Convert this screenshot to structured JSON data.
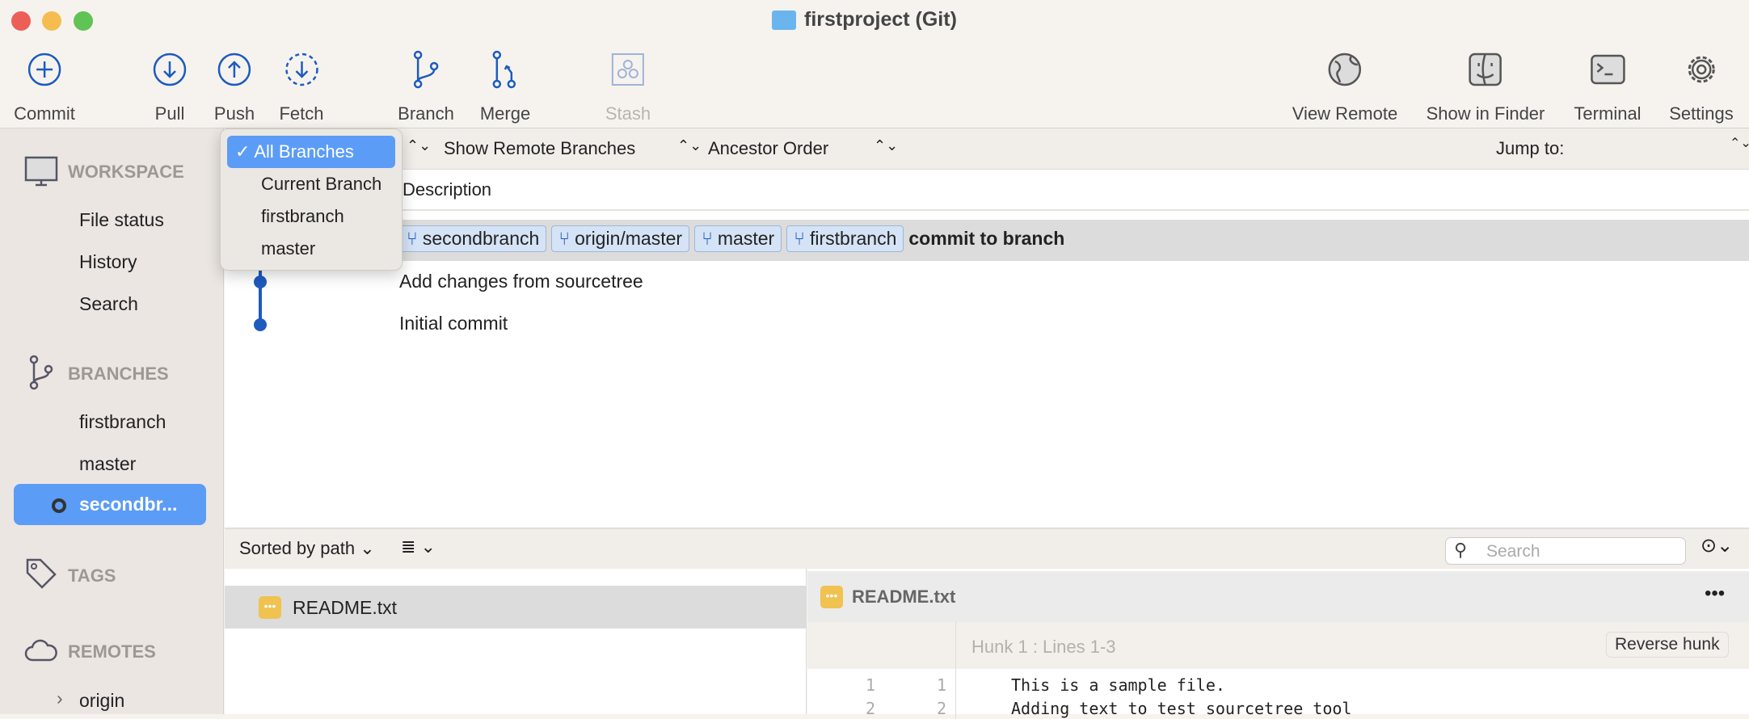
{
  "window": {
    "title": "firstproject (Git)"
  },
  "toolbar": {
    "commit": "Commit",
    "pull": "Pull",
    "push": "Push",
    "fetch": "Fetch",
    "branch": "Branch",
    "merge": "Merge",
    "stash": "Stash",
    "view_remote": "View Remote",
    "show_in_finder": "Show in Finder",
    "terminal": "Terminal",
    "settings": "Settings"
  },
  "sidebar": {
    "workspace": "WORKSPACE",
    "file_status": "File status",
    "history": "History",
    "search": "Search",
    "branches": "BRANCHES",
    "branch_items": [
      "firstbranch",
      "master",
      "secondbr..."
    ],
    "tags": "TAGS",
    "remotes": "REMOTES",
    "remote_items": [
      "origin"
    ]
  },
  "branch_menu": {
    "selected": "All Branches",
    "options": [
      "All Branches",
      "Current Branch",
      "firstbranch",
      "master"
    ],
    "checkmark": "✓"
  },
  "filter": {
    "remote": "Show Remote Branches",
    "order": "Ancestor Order",
    "jump_to": "Jump to:"
  },
  "history": {
    "column_description": "Description",
    "commits": [
      {
        "tags": [
          "secondbranch",
          "origin/master",
          "master",
          "firstbranch"
        ],
        "message": "commit to branch",
        "selected": true
      },
      {
        "tags": [],
        "message": "Add changes from sourcetree"
      },
      {
        "tags": [],
        "message": "Initial commit"
      }
    ]
  },
  "files": {
    "sort": "Sorted by path",
    "search_placeholder": "Search",
    "items": [
      "README.txt"
    ]
  },
  "diff": {
    "file": "README.txt",
    "hunk": "Hunk 1 : Lines 1-3",
    "reverse": "Reverse hunk",
    "lines": [
      {
        "old": "1",
        "new": "1",
        "text": "This is a sample file."
      },
      {
        "old": "2",
        "new": "2",
        "text": "Adding text to test sourcetree tool"
      }
    ]
  },
  "colors": {
    "accent": "#1d5bbf",
    "selection": "#5b9cf6",
    "tag_bg": "#d5e3f6"
  }
}
